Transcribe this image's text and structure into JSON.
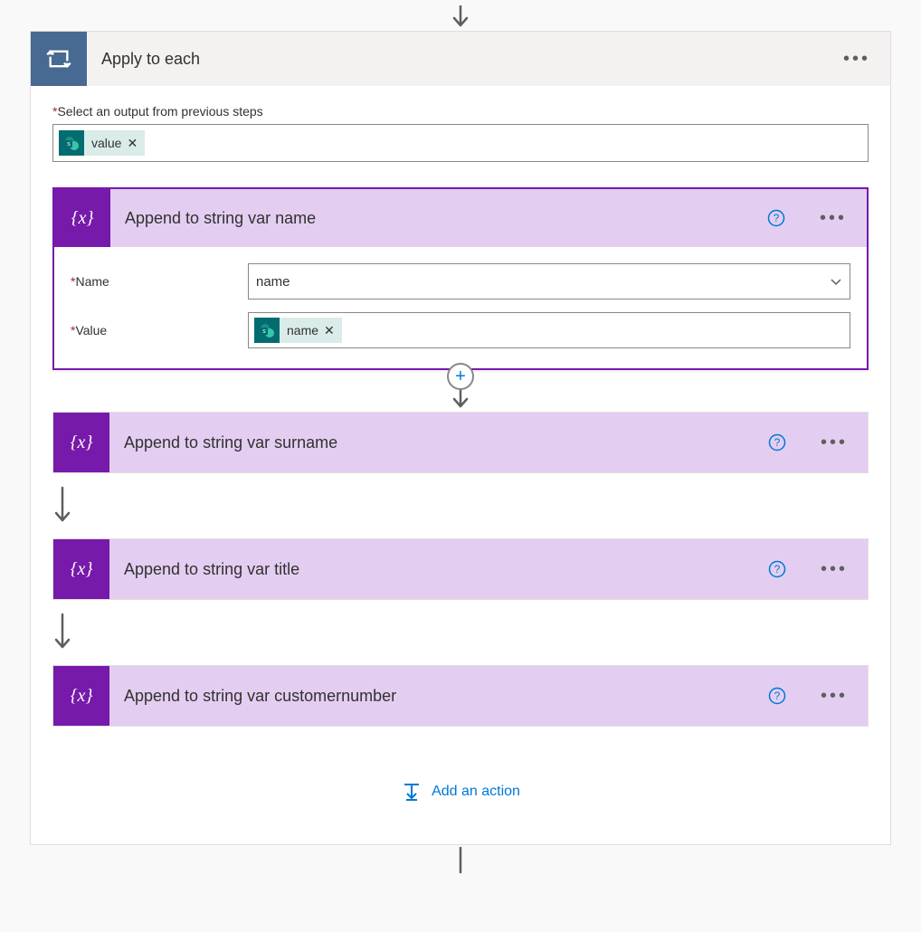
{
  "outer": {
    "title": "Apply to each",
    "select_label": "Select an output from previous steps",
    "select_token": "value",
    "add_action_label": "Add an action"
  },
  "cards": [
    {
      "title": "Append to string var name",
      "expanded": true,
      "name_label": "Name",
      "name_value": "name",
      "value_label": "Value",
      "value_token": "name"
    },
    {
      "title": "Append to string var surname",
      "expanded": false
    },
    {
      "title": "Append to string var title",
      "expanded": false
    },
    {
      "title": "Append to string var customernumber",
      "expanded": false
    }
  ]
}
